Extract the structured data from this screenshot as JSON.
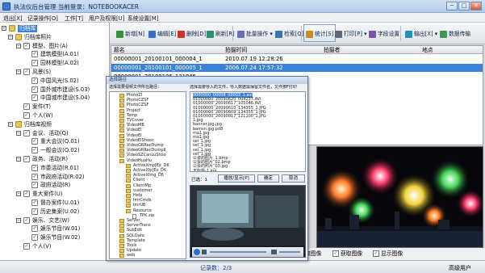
{
  "window": {
    "title": "执法仪后台管理    当前登录：NOTEBOOKACER",
    "min_glyph": "─",
    "max_glyph": "□",
    "close_glyph": "✕"
  },
  "menu": [
    "退出[X]",
    "记录操作[O]",
    "工作[T]",
    "用户及权限[U]",
    "系统设置[M]"
  ],
  "toolbar": [
    {
      "label": "新增[N]",
      "icon": "add-icon",
      "color": "#3c8f3c"
    },
    {
      "label": "编辑[E]",
      "icon": "edit-icon",
      "color": "#3a6fc9"
    },
    {
      "label": "删除[D]",
      "icon": "delete-icon",
      "color": "#c9342b"
    },
    {
      "label": "刷新[R]",
      "icon": "refresh-icon",
      "color": "#2f8e6f"
    },
    {
      "label": "批量操作 ▾",
      "icon": "batch-icon",
      "color": "#6a6fb3"
    },
    {
      "label": "检索[Q] ▾",
      "icon": "search-icon",
      "color": "#3478b8"
    },
    {
      "label": "统计[S]",
      "icon": "stats-icon",
      "color": "#d08a1c"
    },
    {
      "label": "打印[P] ▾",
      "icon": "print-icon",
      "color": "#5a6775"
    },
    {
      "label": "字段设置",
      "icon": "fields-icon",
      "color": "#7c55b0"
    },
    {
      "label": "输出[X] ▾",
      "icon": "export-icon",
      "color": "#2a8fb8"
    },
    {
      "label": "数据传输",
      "icon": "transfer-icon",
      "color": "#3b9a52"
    }
  ],
  "tree": [
    {
      "label": "归档库",
      "level": 0,
      "expander": "−",
      "icon": "folder",
      "hl": true
    },
    {
      "label": "归档库照片",
      "level": 1,
      "expander": "−",
      "icon": "folder"
    },
    {
      "label": "模型、图片(A)",
      "level": 2,
      "expander": "−",
      "icon": "check"
    },
    {
      "label": "建筑模型(A.01)",
      "level": 3,
      "expander": "",
      "icon": "check"
    },
    {
      "label": "园林模型(A.02)",
      "level": 3,
      "expander": "",
      "icon": "check"
    },
    {
      "label": "风景(S)",
      "level": 2,
      "expander": "−",
      "icon": "check"
    },
    {
      "label": "中国风光(S.02)",
      "level": 3,
      "expander": "",
      "icon": "check"
    },
    {
      "label": "国外城市建设(S.03)",
      "level": 3,
      "expander": "",
      "icon": "check"
    },
    {
      "label": "中国城市建设(S.04)",
      "level": 3,
      "expander": "",
      "icon": "check"
    },
    {
      "label": "案件(T)",
      "level": 2,
      "expander": "",
      "icon": "check"
    },
    {
      "label": "个人(W)",
      "level": 2,
      "expander": "",
      "icon": "check"
    },
    {
      "label": "归档库视频",
      "level": 1,
      "expander": "−",
      "icon": "folder"
    },
    {
      "label": "会议、活动(Q)",
      "level": 2,
      "expander": "−",
      "icon": "check"
    },
    {
      "label": "重大会议(Q.01)",
      "level": 3,
      "expander": "",
      "icon": "check"
    },
    {
      "label": "一般会议(Q.02)",
      "level": 3,
      "expander": "",
      "icon": "check"
    },
    {
      "label": "政务、活动(R)",
      "level": 2,
      "expander": "−",
      "icon": "check"
    },
    {
      "label": "市委活动(R.01)",
      "level": 3,
      "expander": "",
      "icon": "check"
    },
    {
      "label": "市政府活动(R.02)",
      "level": 3,
      "expander": "",
      "icon": "check"
    },
    {
      "label": "政府活动(R)",
      "level": 3,
      "expander": "",
      "icon": "check"
    },
    {
      "label": "重大案件(U)",
      "level": 2,
      "expander": "−",
      "icon": "check"
    },
    {
      "label": "督办案件(U.01)",
      "level": 3,
      "expander": "",
      "icon": "check"
    },
    {
      "label": "历史集案(U.02)",
      "level": 3,
      "expander": "",
      "icon": "check"
    },
    {
      "label": "娱乐、文艺(W)",
      "level": 2,
      "expander": "−",
      "icon": "check"
    },
    {
      "label": "娱乐节目(W.01)",
      "level": 3,
      "expander": "",
      "icon": "check"
    },
    {
      "label": "娱乐节目(W.02)",
      "level": 3,
      "expander": "",
      "icon": "check"
    },
    {
      "label": "个人(V)",
      "level": 2,
      "expander": "",
      "icon": "check"
    }
  ],
  "grid": {
    "headers": [
      "题名",
      "拍摄时间",
      "拍摄者",
      "地点"
    ],
    "rows": [
      [
        "00000001_20100101_000004_1",
        "2010.07.19 12:28:26",
        "",
        ""
      ],
      [
        "00000001_20100101_000005_1",
        "2006.07.24 17:57:32",
        "",
        ""
      ],
      [
        "00000001_20100106_131045",
        "",
        "",
        ""
      ]
    ],
    "selected_row": 1
  },
  "dialog": {
    "title": "选择路径",
    "left_caption": "选择需要视频文件所在路径：",
    "folders": [
      "PhotoZI",
      "PhotoCZSF",
      "PhotoCZSF",
      "Project",
      "Temp",
      "TVCover",
      "VideoMB",
      "VideoEI",
      "VideoEI",
      "VideoEIShooc",
      "VideoGRRecDump",
      "VideoGRRecDumpII",
      "VideoSZCanLuShoo",
      "VideoHuaHu",
      "ActiveXmp[Ex_D6",
      "ActiveXlp[Ex_D6",
      "ActiveXImg_D6",
      "Client",
      "ClientMp",
      "customer",
      "Help",
      "ImrCmds",
      "ImrUB",
      "Resource",
      "TPK.zip",
      "Server",
      "ServerTrans",
      "SubEdit",
      "SQLData",
      "Template",
      "Tools",
      "Update",
      "web"
    ],
    "right_caption": "选择需要导入的文件，导入数据需保留文件名，文件按F打印",
    "files": [
      "0000000_00008_00003_1.avi",
      "01000000_20090620_004237.AVI",
      "01000000_20090617_105046.AVI",
      "01000000_20090610_134355_1.JPG",
      "01000000_20090609_134355_1.JPG",
      "01000000_20090817_121100_1.JPG",
      "1.jpg",
      "banner.jpg.jpg",
      "bamsn.jpg.pd8",
      "ma1.jpg",
      "ma1.jpg",
      "sel_1.jpg",
      "sel_1.jpg",
      "sel_1.jpg",
      "sel_1.jpg",
      "公会的照片_1.bmp",
      "公会的照片_02.bmp",
      "公会的照片_03.jpg",
      "无标题-1.jpg"
    ],
    "selected_count": "已选：1",
    "btn_preview": "播放/显示[P]",
    "btn_ok": "确定",
    "btn_cancel": "取消"
  },
  "options": [
    {
      "label": "取图像",
      "checked": true
    },
    {
      "label": "获取图像",
      "checked": true
    },
    {
      "label": "显示图像",
      "checked": true
    }
  ],
  "status": {
    "record_count": "记录数：2/3",
    "user_role": "高级用户"
  },
  "colors": {
    "accent": "#3b82d9",
    "titlebar": "#b3cbe8"
  }
}
